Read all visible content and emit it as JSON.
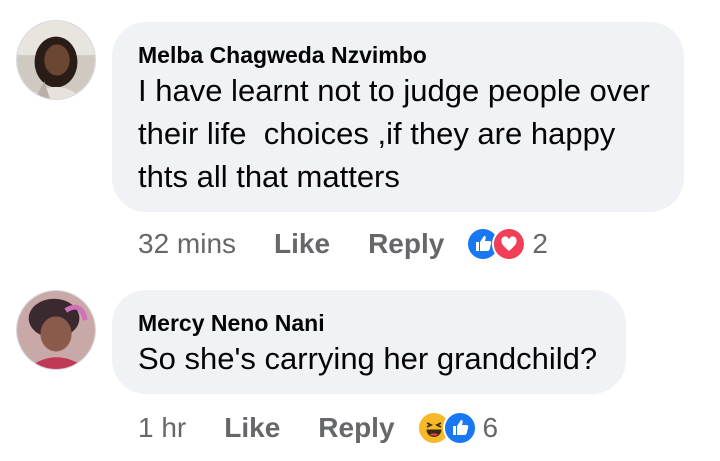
{
  "comments": [
    {
      "author": "Melba Chagweda Nzvimbo",
      "text_lines": [
        "I have learnt not to judge people over",
        "their life  choices ,if they are happy",
        "thts all that matters"
      ],
      "time": "32 mins",
      "like_label": "Like",
      "reply_label": "Reply",
      "reactions": [
        "like-reaction-icon",
        "love-reaction-icon"
      ],
      "reaction_count": "2"
    },
    {
      "author": "Mercy Neno Nani",
      "text_lines": [
        "So she's carrying her grandchild?"
      ],
      "time": "1 hr",
      "like_label": "Like",
      "reply_label": "Reply",
      "reactions": [
        "haha-reaction-icon",
        "like-reaction-icon"
      ],
      "reaction_count": "6"
    }
  ],
  "colors": {
    "bubble": "#f0f2f5",
    "meta_text": "#65676b",
    "like_blue": "#1877f2",
    "love_red": "#f33e58",
    "haha_yellow": "#f7b928"
  }
}
